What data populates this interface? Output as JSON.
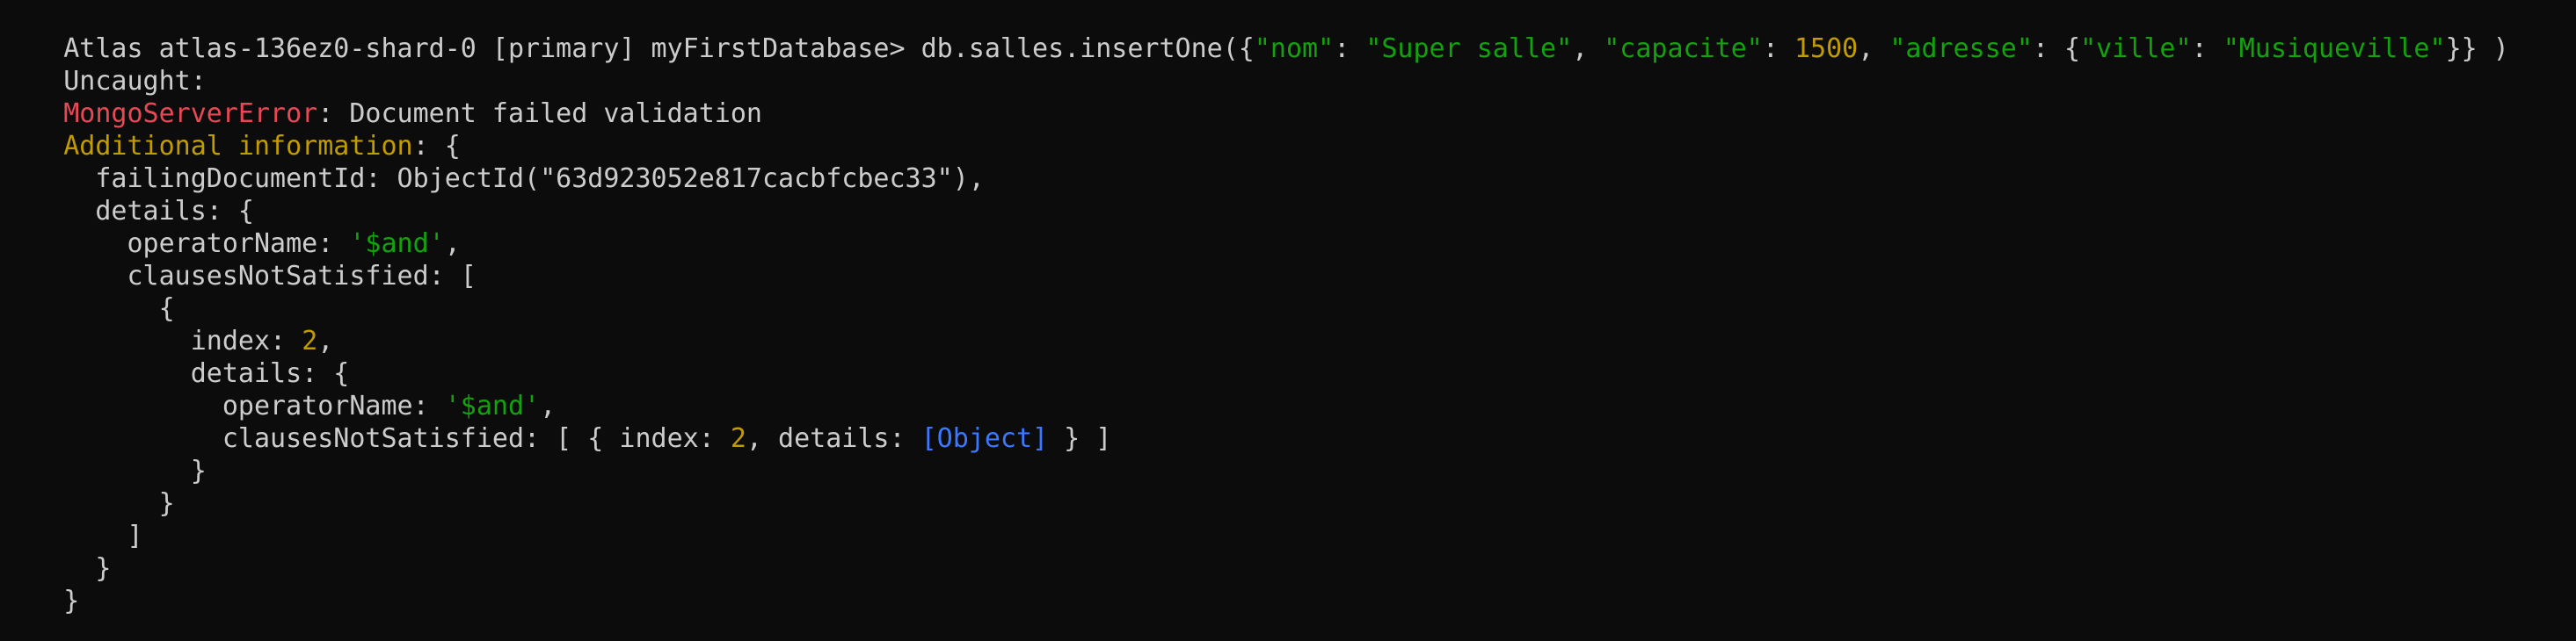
{
  "colors": {
    "background": "#0c0c0c",
    "default": "#cccccc",
    "string": "#13a10e",
    "number": "#c19c00",
    "error": "#e74856",
    "object_ref": "#3b78ff"
  },
  "terminal": {
    "lines": [
      {
        "segments": [
          {
            "text": "Atlas atlas-136ez0-shard-0 [primary] myFirstDatabase> db.salles.insertOne({",
            "color": "default"
          },
          {
            "text": "\"nom\"",
            "color": "green"
          },
          {
            "text": ": ",
            "color": "default"
          },
          {
            "text": "\"Super salle\"",
            "color": "green"
          },
          {
            "text": ", ",
            "color": "default"
          },
          {
            "text": "\"capacite\"",
            "color": "green"
          },
          {
            "text": ": ",
            "color": "default"
          },
          {
            "text": "1500",
            "color": "yellow"
          },
          {
            "text": ", ",
            "color": "default"
          },
          {
            "text": "\"adresse\"",
            "color": "green"
          },
          {
            "text": ": {",
            "color": "default"
          },
          {
            "text": "\"ville\"",
            "color": "green"
          },
          {
            "text": ": ",
            "color": "default"
          },
          {
            "text": "\"Musiqueville\"",
            "color": "green"
          },
          {
            "text": "}} )",
            "color": "default"
          }
        ]
      },
      {
        "segments": [
          {
            "text": "Uncaught:",
            "color": "default"
          }
        ]
      },
      {
        "segments": [
          {
            "text": "MongoServerError",
            "color": "red"
          },
          {
            "text": ": Document failed validation",
            "color": "default"
          }
        ]
      },
      {
        "segments": [
          {
            "text": "Additional information",
            "color": "yellow"
          },
          {
            "text": ": {",
            "color": "default"
          }
        ]
      },
      {
        "segments": [
          {
            "text": "  failingDocumentId: ObjectId(\"63d923052e817cacbfcbec33\"),",
            "color": "default"
          }
        ]
      },
      {
        "segments": [
          {
            "text": "  details: {",
            "color": "default"
          }
        ]
      },
      {
        "segments": [
          {
            "text": "    operatorName: ",
            "color": "default"
          },
          {
            "text": "'$and'",
            "color": "green"
          },
          {
            "text": ",",
            "color": "default"
          }
        ]
      },
      {
        "segments": [
          {
            "text": "    clausesNotSatisfied: [",
            "color": "default"
          }
        ]
      },
      {
        "segments": [
          {
            "text": "      {",
            "color": "default"
          }
        ]
      },
      {
        "segments": [
          {
            "text": "        index: ",
            "color": "default"
          },
          {
            "text": "2",
            "color": "yellow"
          },
          {
            "text": ",",
            "color": "default"
          }
        ]
      },
      {
        "segments": [
          {
            "text": "        details: {",
            "color": "default"
          }
        ]
      },
      {
        "segments": [
          {
            "text": "          operatorName: ",
            "color": "default"
          },
          {
            "text": "'$and'",
            "color": "green"
          },
          {
            "text": ",",
            "color": "default"
          }
        ]
      },
      {
        "segments": [
          {
            "text": "          clausesNotSatisfied: [ { index: ",
            "color": "default"
          },
          {
            "text": "2",
            "color": "yellow"
          },
          {
            "text": ", details: ",
            "color": "default"
          },
          {
            "text": "[Object]",
            "color": "blue"
          },
          {
            "text": " } ]",
            "color": "default"
          }
        ]
      },
      {
        "segments": [
          {
            "text": "        }",
            "color": "default"
          }
        ]
      },
      {
        "segments": [
          {
            "text": "      }",
            "color": "default"
          }
        ]
      },
      {
        "segments": [
          {
            "text": "    ]",
            "color": "default"
          }
        ]
      },
      {
        "segments": [
          {
            "text": "  }",
            "color": "default"
          }
        ]
      },
      {
        "segments": [
          {
            "text": "}",
            "color": "default"
          }
        ]
      }
    ]
  }
}
